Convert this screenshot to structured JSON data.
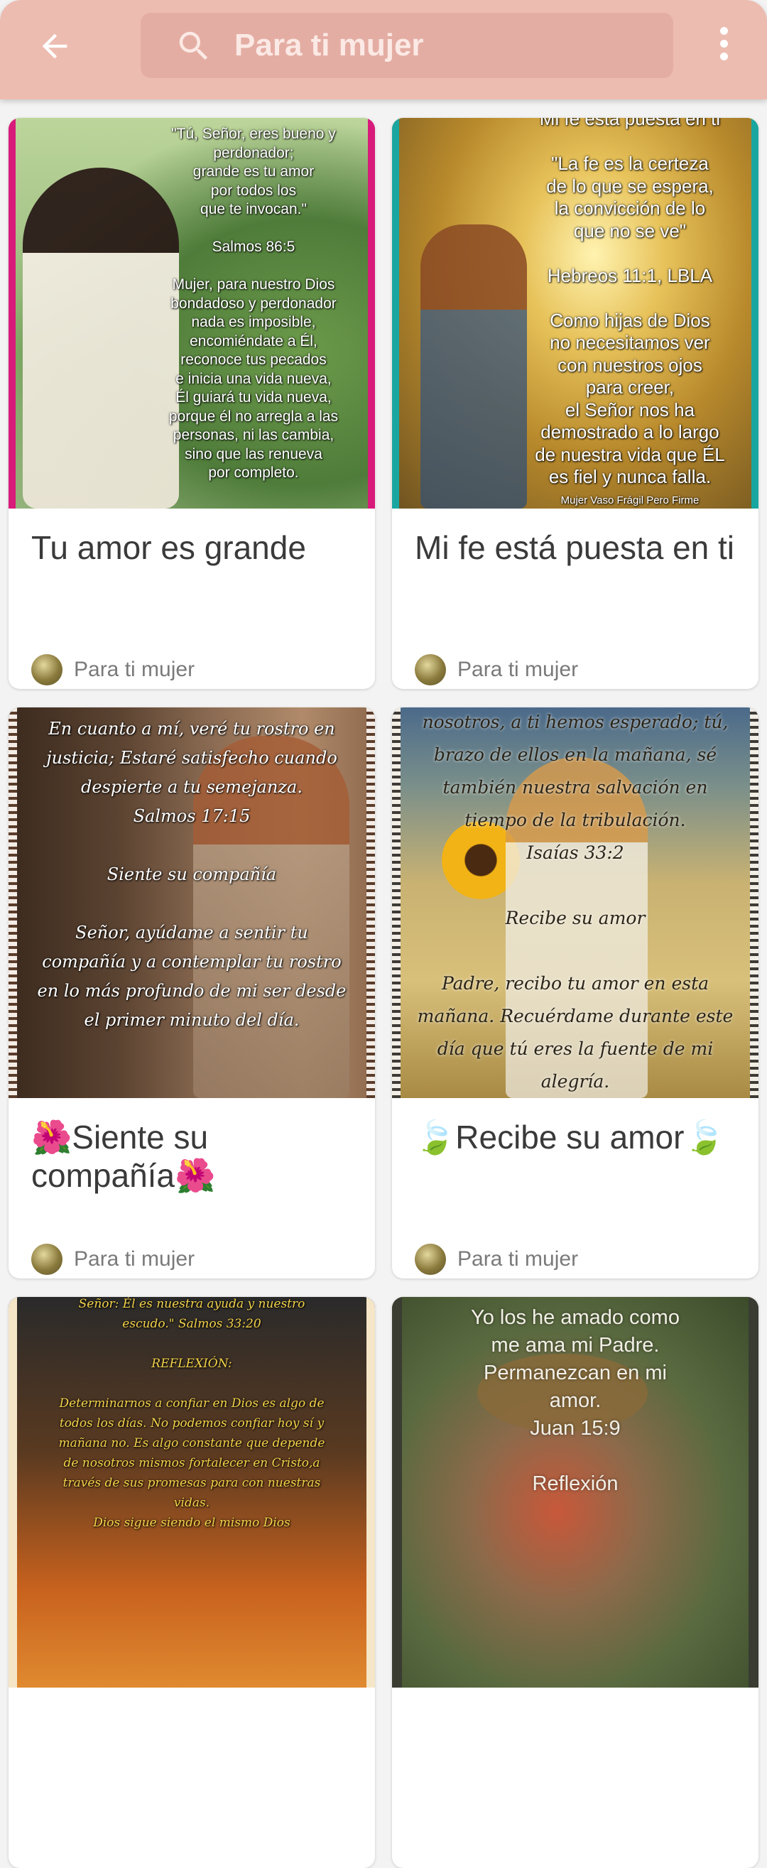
{
  "header": {
    "back_icon": "arrow-left-icon",
    "search_icon": "search-icon",
    "search_text": "Para ti mujer",
    "menu_icon": "more-vertical-icon"
  },
  "colors": {
    "appbar": "#edbcb0",
    "search_field": "#e4ada3",
    "background": "#f3f3f3",
    "card": "#ffffff",
    "title_text": "#3a3a3a",
    "author_text": "#7a7a7a"
  },
  "cards": [
    {
      "title": "Tu amor es grande",
      "author": "Para ti mujer",
      "image_text": "\"Tú, Señor, eres bueno y\nperdonador;\ngrande es tu amor\npor todos los\nque te invocan.\"\n\nSalmos 86:5\n\nMujer, para nuestro Dios\nbondadoso y perdonador\nnada es imposible,\nencomiéndate a Él,\nreconoce tus pecados\ne inicia una vida nueva,\nÉl guiará tu vida nueva,\nporque él no arregla a las\npersonas, ni las cambia,\nsino que las renueva\npor completo."
    },
    {
      "title": "Mi fe está puesta en ti",
      "author": "Para ti mujer",
      "image_text": "Mi fe está puesta en ti\n\n\"La fe es la certeza\nde lo que se espera,\nla convicción de lo\nque no se ve\"\n\nHebreos 11:1, LBLA\n\nComo hijas de Dios\nno necesitamos ver\ncon nuestros ojos\npara creer,\nel Señor nos ha\ndemostrado a lo largo\nde nuestra vida que ÉL\nes fiel y nunca falla.",
      "image_footer": "Mujer Vaso Frágil Pero Firme"
    },
    {
      "title": "🌺Siente su compañía🌺",
      "author": "Para ti mujer",
      "image_text": "En cuanto a mí, veré tu rostro en\njusticia; Estaré satisfecho cuando\ndespierte a tu semejanza.\nSalmos 17:15\n\nSiente su compañía\n\nSeñor, ayúdame a sentir tu\ncompañía y a contemplar tu rostro\nen lo más profundo de mi ser desde\nel primer minuto del día."
    },
    {
      "title": "🍃Recibe su amor🍃",
      "author": "Para ti mujer",
      "image_text": "nosotros, a ti hemos esperado; tú,\nbrazo de ellos en la mañana, sé\ntambién nuestra salvación en\ntiempo de la tribulación.\nIsaías 33:2\n\nRecibe su amor\n\nPadre, recibo tu amor en esta\nmañana. Recuérdame durante este\ndía que tú eres la fuente de mi\nalegría."
    },
    {
      "title": "",
      "author": "",
      "image_text": "Señor: Él es nuestra ayuda y nuestro\nescudo.\" Salmos 33:20\n\nREFLEXIÓN:\n\nDeterminarnos a confiar en Dios es algo de\ntodos los días. No podemos confiar hoy sí y\nmañana no. Es algo constante que depende\nde nosotros mismos fortalecer en Cristo,a\ntravés de sus promesas para con nuestras\nvidas.\nDios sigue siendo el mismo Dios"
    },
    {
      "title": "",
      "author": "",
      "image_text": "Yo los he amado como\nme ama mi Padre.\nPermanezcan en mi\namor.\nJuan 15:9\n\nReflexión"
    }
  ]
}
